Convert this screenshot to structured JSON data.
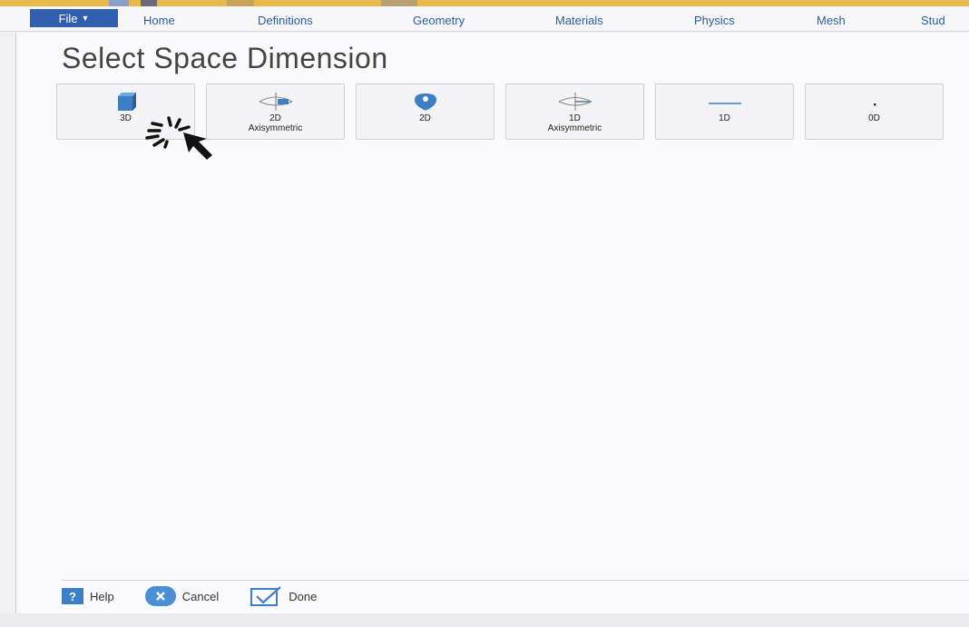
{
  "ribbon": {
    "file_label": "File",
    "tabs": [
      "Home",
      "Definitions",
      "Geometry",
      "Materials",
      "Physics",
      "Mesh",
      "Stud"
    ]
  },
  "panel": {
    "title": "Select Space Dimension",
    "dimension_options": [
      {
        "line1": "3D",
        "line2": "",
        "icon": "cube-3d-icon"
      },
      {
        "line1": "2D",
        "line2": "Axisymmetric",
        "icon": "axisymmetric-2d-icon"
      },
      {
        "line1": "2D",
        "line2": "",
        "icon": "plane-2d-icon"
      },
      {
        "line1": "1D",
        "line2": "Axisymmetric",
        "icon": "axisymmetric-1d-icon"
      },
      {
        "line1": "1D",
        "line2": "",
        "icon": "line-1d-icon"
      },
      {
        "line1": "0D",
        "line2": "",
        "icon": "point-0d-icon"
      }
    ]
  },
  "footer": {
    "help_label": "Help",
    "help_glyph": "?",
    "cancel_label": "Cancel",
    "done_label": "Done"
  },
  "colors": {
    "accent": "#2f5fae",
    "tab_text": "#2a5d9e",
    "icon_blue": "#3c7fc7",
    "title_bar": "#e9b84a"
  }
}
